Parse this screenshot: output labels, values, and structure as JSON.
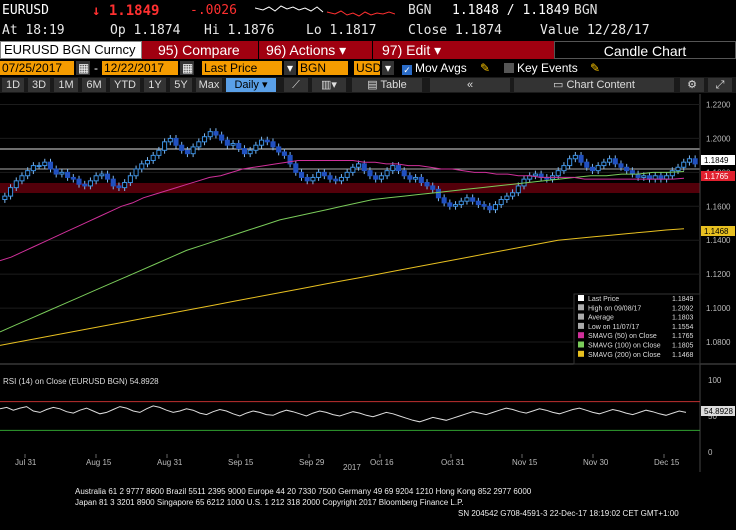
{
  "quote": {
    "symbol": "EURUSD",
    "price": "↓ 1.1849",
    "change": "-.0026",
    "source": "BGN",
    "bid_ask": "1.1848 / 1.1849",
    "source2": "BGN"
  },
  "ohlc": {
    "at": "At 18:19",
    "open": "Op 1.1874",
    "high": "Hi 1.1876",
    "low": "Lo 1.1817",
    "close": "Close 1.1874",
    "value": "Value 12/28/17"
  },
  "toolbar": {
    "security": "EURUSD BGN Curncy",
    "compare": "95) Compare",
    "actions": "96) Actions",
    "edit": "97) Edit",
    "title": "Candle Chart"
  },
  "range": {
    "start": "07/25/2017",
    "end": "12/22/2017",
    "field": "Last Price",
    "source": "BGN",
    "currency": "USD",
    "mov_avgs": "Mov Avgs",
    "key_events": "Key Events"
  },
  "periods": {
    "items": [
      "1D",
      "3D",
      "1M",
      "6M",
      "YTD",
      "1Y",
      "5Y",
      "Max"
    ],
    "frequency": "Daily",
    "table": "Table",
    "chart_content": "Chart Content"
  },
  "colors": {
    "up": "#3a8fe0",
    "down": "#2050c0",
    "sma50": "#d0309a",
    "sma100": "#7acb5a",
    "sma200": "#e8c020",
    "band": "#8a0010"
  },
  "chart_data": {
    "type": "candlestick",
    "x_ticks": [
      "Jul 31",
      "Aug 15",
      "Aug 31",
      "Sep 15",
      "Sep 29",
      "Oct 16",
      "Oct 31",
      "Nov 15",
      "Nov 30",
      "Dec 15"
    ],
    "year_label": "2017",
    "y_ticks": [
      "1.2200",
      "1.2000",
      "1.1800",
      "1.1600",
      "1.1400",
      "1.1200",
      "1.1000",
      "1.0800"
    ],
    "ylim": [
      1.07,
      1.225
    ],
    "last_price": "1.1849",
    "sma50_value": "1.1765",
    "sma200_value": "1.1468",
    "closes": [
      1.166,
      1.171,
      1.175,
      1.178,
      1.181,
      1.184,
      1.184,
      1.186,
      1.182,
      1.179,
      1.18,
      1.177,
      1.176,
      1.173,
      1.172,
      1.175,
      1.178,
      1.179,
      1.176,
      1.172,
      1.171,
      1.174,
      1.178,
      1.182,
      1.185,
      1.187,
      1.19,
      1.193,
      1.198,
      1.2,
      1.196,
      1.193,
      1.191,
      1.195,
      1.198,
      1.201,
      1.204,
      1.202,
      1.199,
      1.196,
      1.197,
      1.194,
      1.191,
      1.193,
      1.196,
      1.199,
      1.198,
      1.195,
      1.192,
      1.19,
      1.185,
      1.18,
      1.177,
      1.175,
      1.177,
      1.18,
      1.178,
      1.176,
      1.175,
      1.177,
      1.18,
      1.183,
      1.185,
      1.181,
      1.178,
      1.176,
      1.178,
      1.181,
      1.184,
      1.181,
      1.178,
      1.176,
      1.177,
      1.174,
      1.172,
      1.17,
      1.165,
      1.162,
      1.16,
      1.161,
      1.163,
      1.165,
      1.163,
      1.161,
      1.16,
      1.158,
      1.161,
      1.164,
      1.166,
      1.168,
      1.172,
      1.176,
      1.178,
      1.179,
      1.177,
      1.176,
      1.178,
      1.181,
      1.184,
      1.188,
      1.19,
      1.186,
      1.183,
      1.181,
      1.184,
      1.186,
      1.188,
      1.185,
      1.183,
      1.181,
      1.179,
      1.177,
      1.178,
      1.176,
      1.178,
      1.176,
      1.178,
      1.181,
      1.183,
      1.186,
      1.188,
      1.185
    ],
    "sma50": [
      1.128,
      1.13,
      1.133,
      1.136,
      1.139,
      1.142,
      1.145,
      1.148,
      1.151,
      1.154,
      1.157,
      1.16,
      1.162,
      1.165,
      1.167,
      1.169,
      1.171,
      1.173,
      1.175,
      1.177,
      1.178,
      1.18,
      1.182,
      1.183,
      1.184,
      1.185,
      1.186,
      1.187,
      1.187,
      1.187,
      1.187,
      1.187,
      1.187,
      1.186,
      1.186,
      1.185,
      1.185,
      1.184,
      1.184,
      1.183,
      1.182,
      1.182,
      1.181,
      1.18,
      1.18,
      1.179,
      1.179,
      1.178,
      1.178,
      1.177,
      1.177,
      1.177,
      1.177,
      1.176,
      1.176,
      1.176,
      1.176,
      1.176,
      1.176,
      1.176,
      1.176,
      1.176,
      1.1765
    ],
    "sma100": [
      1.086,
      1.09,
      1.094,
      1.098,
      1.102,
      1.106,
      1.11,
      1.114,
      1.118,
      1.122,
      1.126,
      1.13,
      1.134,
      1.137,
      1.14,
      1.143,
      1.146,
      1.149,
      1.152,
      1.154,
      1.156,
      1.158,
      1.16,
      1.162,
      1.164,
      1.165,
      1.166,
      1.167,
      1.168,
      1.169,
      1.17,
      1.171,
      1.172,
      1.173,
      1.174,
      1.175,
      1.176,
      1.177,
      1.178,
      1.178,
      1.179,
      1.179,
      1.18,
      1.18,
      1.1805
    ],
    "sma200": [
      1.078,
      1.08,
      1.082,
      1.084,
      1.086,
      1.088,
      1.09,
      1.092,
      1.094,
      1.096,
      1.098,
      1.1,
      1.102,
      1.104,
      1.106,
      1.108,
      1.11,
      1.112,
      1.114,
      1.116,
      1.118,
      1.12,
      1.122,
      1.124,
      1.126,
      1.128,
      1.13,
      1.132,
      1.134,
      1.136,
      1.138,
      1.14,
      1.141,
      1.142,
      1.143,
      1.144,
      1.145,
      1.146,
      1.1468
    ],
    "legend": [
      {
        "label": "Last Price",
        "value": "1.1849",
        "color": "#ffffff"
      },
      {
        "label": "High on 09/08/17",
        "value": "1.2092",
        "color": "#aaaaaa"
      },
      {
        "label": "Average",
        "value": "1.1803",
        "color": "#aaaaaa"
      },
      {
        "label": "Low on 11/07/17",
        "value": "1.1554",
        "color": "#aaaaaa"
      },
      {
        "label": "SMAVG (50) on Close",
        "value": "1.1765",
        "color": "#d0309a"
      },
      {
        "label": "SMAVG (100) on Close",
        "value": "1.1805",
        "color": "#7acb5a"
      },
      {
        "label": "SMAVG (200) on Close",
        "value": "1.1468",
        "color": "#e8c020"
      }
    ],
    "rsi": {
      "label": "RSI (14) on Close (EURUSD BGN) 54.8928",
      "value": "54.8928",
      "y_ticks": [
        "100",
        "50",
        "0"
      ],
      "series": [
        60,
        62,
        58,
        61,
        63,
        57,
        55,
        59,
        62,
        60,
        56,
        54,
        58,
        61,
        57,
        53,
        55,
        59,
        63,
        61,
        57,
        55,
        60,
        64,
        62,
        58,
        55,
        57,
        60,
        58,
        54,
        52,
        56,
        59,
        57,
        53,
        50,
        54,
        57,
        55,
        52,
        51,
        55,
        58,
        56,
        53,
        50,
        54,
        57,
        55,
        52,
        50,
        53,
        56,
        54,
        51,
        49,
        52,
        55,
        53,
        50,
        47,
        44,
        42,
        45,
        48,
        46,
        44,
        47,
        50,
        53,
        56,
        54,
        52,
        55,
        58,
        61,
        59,
        56,
        54,
        57,
        60,
        58,
        55,
        53,
        56,
        59,
        61,
        58,
        55,
        53,
        56,
        59,
        57,
        54,
        52,
        55,
        58,
        56,
        53,
        51,
        54,
        57,
        55
      ]
    }
  },
  "footer": {
    "line1": "Australia 61 2 9777 8600 Brazil 5511 2395 9000 Europe 44 20 7330 7500 Germany 49 69 9204 1210 Hong Kong 852 2977 6000",
    "line2": "Japan 81 3 3201 8900         Singapore 65 6212 1000         U.S. 1 212 318 2000         Copyright 2017 Bloomberg Finance L.P.",
    "line3": "SN 204542 G708-4591-3 22-Dec-17 18:19:02 CET  GMT+1:00"
  }
}
